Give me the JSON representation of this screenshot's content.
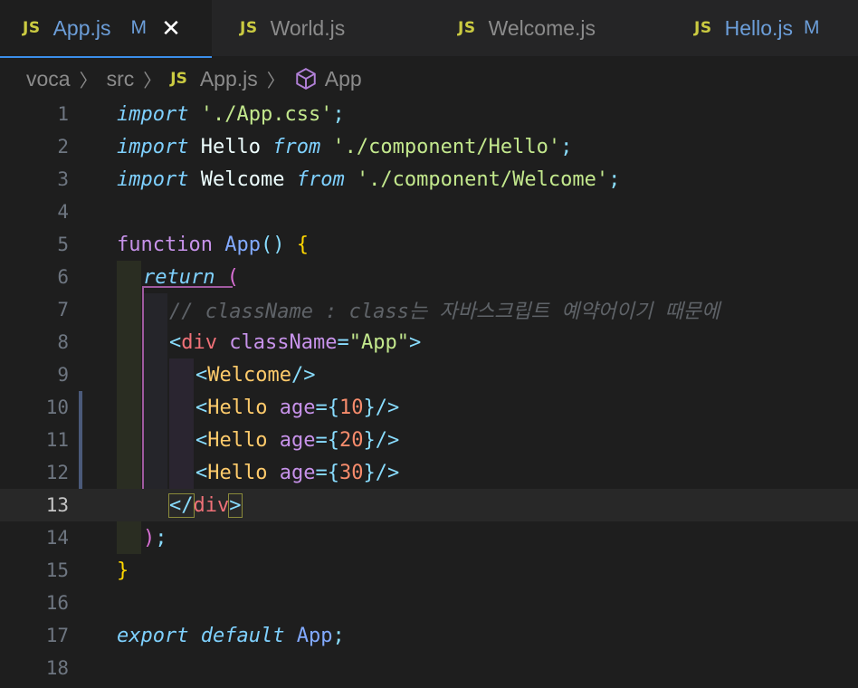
{
  "tabs": [
    {
      "icon": "JS",
      "label": "App.js",
      "status": "M",
      "close": "✕"
    },
    {
      "icon": "JS",
      "label": "World.js"
    },
    {
      "icon": "JS",
      "label": "Welcome.js"
    },
    {
      "icon": "JS",
      "label": "Hello.js",
      "status": "M"
    }
  ],
  "breadcrumb": [
    "voca",
    "src",
    "App.js",
    "App"
  ],
  "breadcrumb_js_icon": "JS",
  "line_numbers": [
    "1",
    "2",
    "3",
    "4",
    "5",
    "6",
    "7",
    "8",
    "9",
    "10",
    "11",
    "12",
    "13",
    "14",
    "15",
    "16",
    "17",
    "18"
  ],
  "current_line": 13,
  "code": {
    "l1": {
      "import": "import",
      "sp": " ",
      "str": "'./App.css'",
      "semi": ";"
    },
    "l2": {
      "import": "import",
      "name": " Hello ",
      "from": "from",
      "sp": " ",
      "str": "'./component/Hello'",
      "semi": ";"
    },
    "l3": {
      "import": "import",
      "name": " Welcome ",
      "from": "from",
      "sp": " ",
      "str": "'./component/Welcome'",
      "semi": ";"
    },
    "l5": {
      "function": "function",
      "sp": " ",
      "name": "App",
      "parens": "()",
      "sp2": " ",
      "brace": "{"
    },
    "l6": {
      "return": "return",
      "sp": " ",
      "paren": "("
    },
    "l7": {
      "comment": "// className : class는 자바스크립트 예약어이기 때문에"
    },
    "l8": {
      "open": "<",
      "tag": "div",
      "sp": " ",
      "attr": "className",
      "eq": "=",
      "str": "\"App\"",
      "close": ">"
    },
    "l9": {
      "open": "<",
      "comp": "Welcome",
      "close": "/>"
    },
    "l10": {
      "open": "<",
      "comp": "Hello",
      "sp": " ",
      "attr": "age",
      "eq": "=",
      "lb": "{",
      "num": "10",
      "rb": "}",
      "close": "/>"
    },
    "l11": {
      "open": "<",
      "comp": "Hello",
      "sp": " ",
      "attr": "age",
      "eq": "=",
      "lb": "{",
      "num": "20",
      "rb": "}",
      "close": "/>"
    },
    "l12": {
      "open": "<",
      "comp": "Hello",
      "sp": " ",
      "attr": "age",
      "eq": "=",
      "lb": "{",
      "num": "30",
      "rb": "}",
      "close": "/>"
    },
    "l13": {
      "open": "</",
      "tag": "div",
      "close": ">"
    },
    "l14": {
      "paren": ")",
      "semi": ";"
    },
    "l15": {
      "brace": "}"
    },
    "l17": {
      "export": "export",
      "sp": " ",
      "default": "default",
      "sp2": " ",
      "name": "App",
      "semi": ";"
    }
  },
  "colors": {
    "background": "#1e1e1e",
    "tab_bar": "#252526",
    "active_tab_underline": "#3b8eea",
    "js_icon": "#cbcb41",
    "modified": "#6c9ed9"
  }
}
